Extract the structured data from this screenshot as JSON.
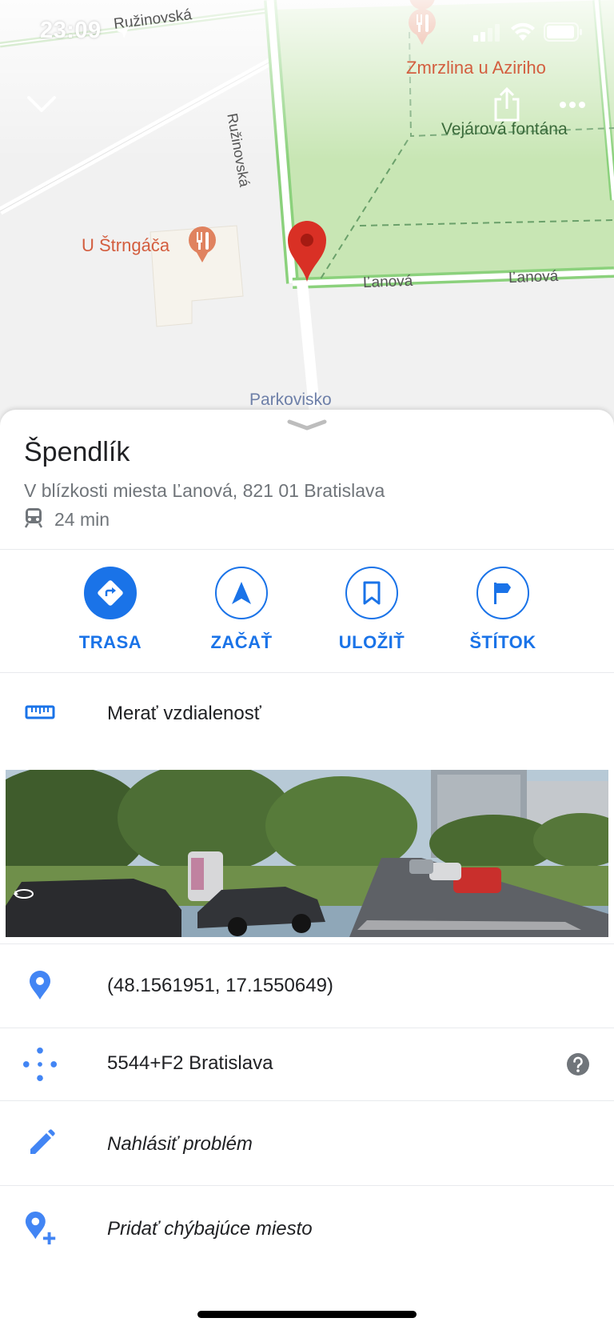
{
  "status_bar": {
    "time": "23:09",
    "icons": [
      "location-arrow-icon",
      "cellular-signal-icon",
      "wifi-icon",
      "battery-icon"
    ]
  },
  "map": {
    "labels": {
      "street_top": "Ružinovská",
      "street_vertical": "Ružinovská",
      "restaurant_1": "Zmrzlina u Aziriho",
      "park_fountain": "Vejárová fontána",
      "restaurant_2": "U Štrngáča",
      "street_lanova_1": "Ľanová",
      "street_lanova_2": "Ľanová",
      "parking": "Parkovisko"
    },
    "colors": {
      "park": "#c8e6b4",
      "park_border": "#8bd17c",
      "pin": "#d93025",
      "poi": "#d35e3f"
    },
    "controls": {
      "collapse_icon": "chevron-down-icon",
      "share_icon": "share-icon",
      "more_icon": "more-horizontal-icon"
    }
  },
  "place": {
    "title": "Špendlík",
    "address": "V blízkosti miesta Ľanová, 821 01 Bratislava",
    "transit_icon": "train-icon",
    "transit_time": "24 min"
  },
  "actions": [
    {
      "label": "TRASA",
      "icon": "directions-icon"
    },
    {
      "label": "ZAČAŤ",
      "icon": "navigation-arrow-icon"
    },
    {
      "label": "ULOŽIŤ",
      "icon": "bookmark-icon"
    },
    {
      "label": "ŠTÍTOK",
      "icon": "flag-icon"
    }
  ],
  "measure": {
    "label": "Merať vzdialenosť",
    "icon": "ruler-icon"
  },
  "street_view": {
    "icon": "street-view-360-icon"
  },
  "details": {
    "coordinates": "(48.1561951, 17.1550649)",
    "plus_code": "5544+F2 Bratislava",
    "report_problem": "Nahlásiť problém",
    "add_missing_place": "Pridať chýbajúce miesto"
  },
  "accent_color": "#1a73e8"
}
